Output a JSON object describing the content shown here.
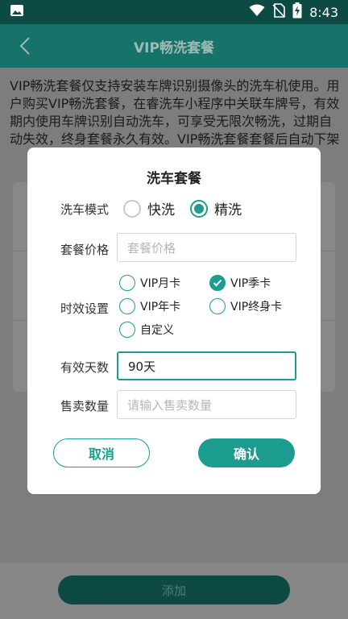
{
  "status_bar": {
    "time": "8:43"
  },
  "header": {
    "title": "VIP畅洗套餐"
  },
  "page": {
    "description": "VIP畅洗套餐仅支持安装车牌识别摄像头的洗车机使用。用户购买VIP畅洗套餐，在睿洗车小程序中关联车牌号，有效期内使用车牌识别自动洗车，可享受无限次畅洗，过期自动失效，终身套餐永久有效。VIP畅洗套餐套餐后自动下架",
    "add_button": "添加"
  },
  "dialog": {
    "title": "洗车套餐",
    "wash_mode": {
      "label": "洗车模式",
      "options": [
        "快洗",
        "精洗"
      ],
      "selected": "精洗"
    },
    "price": {
      "label": "套餐价格",
      "placeholder": "套餐价格",
      "value": ""
    },
    "validity": {
      "label": "时效设置",
      "options": [
        "VIP月卡",
        "VIP季卡",
        "VIP年卡",
        "VIP终身卡",
        "自定义"
      ],
      "selected": "VIP季卡"
    },
    "days": {
      "label": "有效天数",
      "value": "90天"
    },
    "quantity": {
      "label": "售卖数量",
      "placeholder": "请输入售卖数量",
      "value": ""
    },
    "cancel_label": "取消",
    "confirm_label": "确认"
  },
  "colors": {
    "accent": "#1b9c8f",
    "header": "#16736a",
    "status_bar": "#0d4a44"
  }
}
